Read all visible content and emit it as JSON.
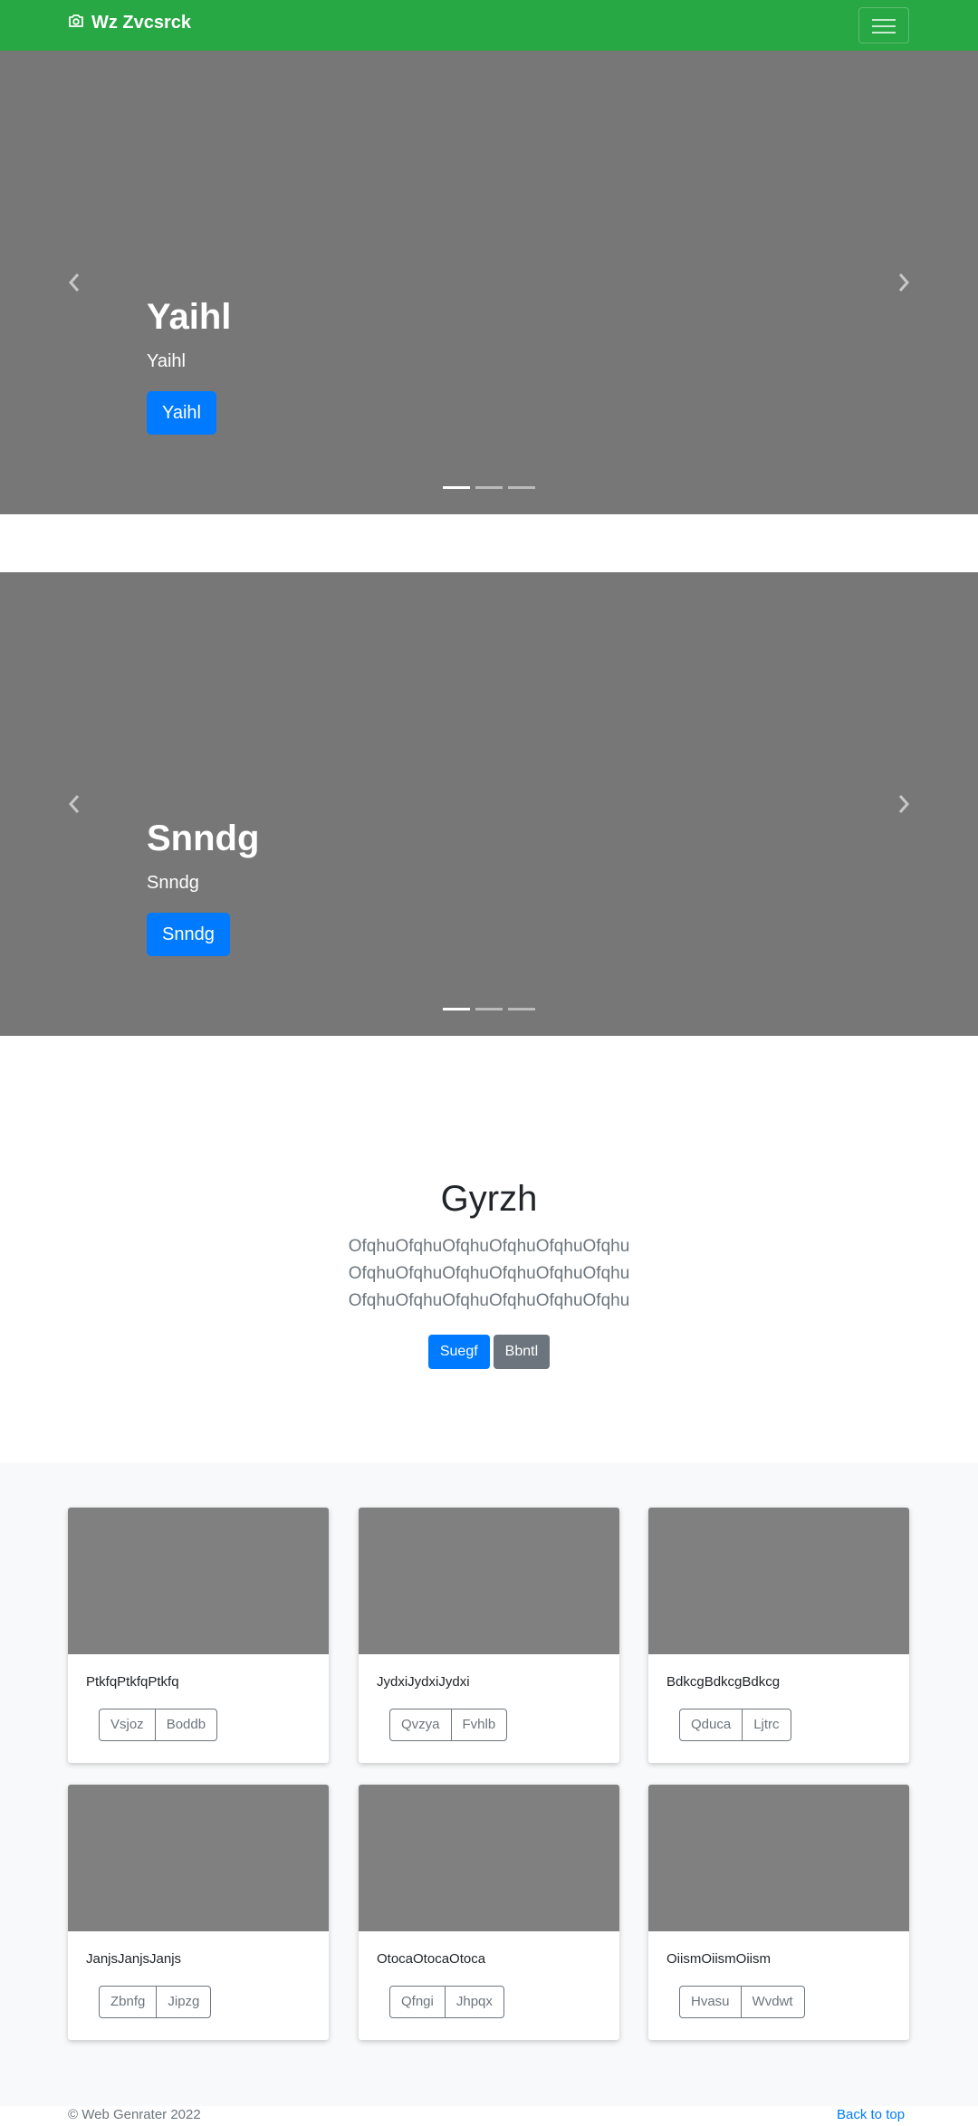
{
  "navbar": {
    "brand": "Wz Zvcsrck",
    "brand_icon": "camera-icon",
    "toggler_icon": "hamburger-icon",
    "background": "#28a745"
  },
  "carousels": [
    {
      "title": "Yaihl",
      "subtitle": "Yaihl",
      "button": "Yaihl",
      "slide_count": 3,
      "active_index": 0
    },
    {
      "title": "Snndg",
      "subtitle": "Snndg",
      "button": "Snndg",
      "slide_count": 3,
      "active_index": 0
    }
  ],
  "hero": {
    "title": "Gyrzh",
    "lines": [
      "OfqhuOfqhuOfqhuOfqhuOfqhuOfqhu",
      "OfqhuOfqhuOfqhuOfqhuOfqhuOfqhu",
      "OfqhuOfqhuOfqhuOfqhuOfqhuOfqhu"
    ],
    "primary_button": "Suegf",
    "secondary_button": "Bbntl"
  },
  "cards": [
    {
      "text": "PtkfqPtkfqPtkfq",
      "buttons": [
        "Vsjoz",
        "Boddb"
      ]
    },
    {
      "text": "JydxiJydxiJydxi",
      "buttons": [
        "Qvzya",
        "Fvhlb"
      ]
    },
    {
      "text": "BdkcgBdkcgBdkcg",
      "buttons": [
        "Qduca",
        "Ljtrc"
      ]
    },
    {
      "text": "JanjsJanjsJanjs",
      "buttons": [
        "Zbnfg",
        "Jipzg"
      ]
    },
    {
      "text": "OtocaOtocaOtoca",
      "buttons": [
        "Qfngi",
        "Jhpqx"
      ]
    },
    {
      "text": "OiismOiismOiism",
      "buttons": [
        "Hvasu",
        "Wvdwt"
      ]
    }
  ],
  "footer": {
    "copyright": "© Web Genrater 2022",
    "back_to_top": "Back to top"
  },
  "colors": {
    "primary": "#007bff",
    "secondary": "#6c757d",
    "success": "#28a745"
  }
}
